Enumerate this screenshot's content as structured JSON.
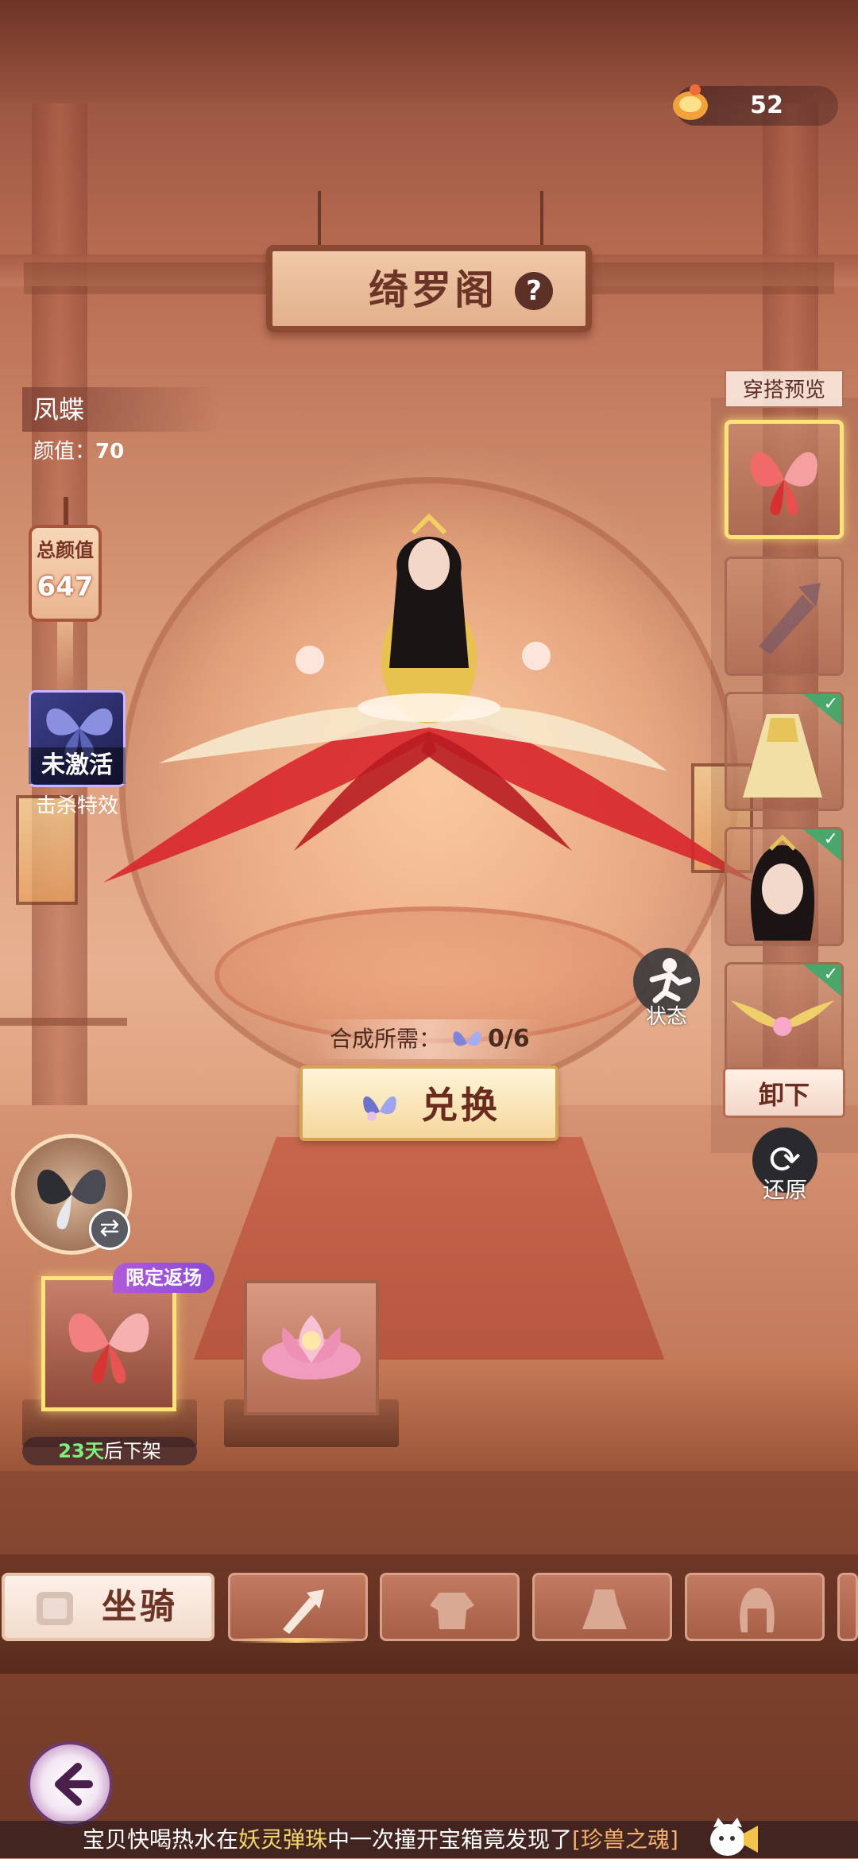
{
  "currency": {
    "amount": "52",
    "icon": "ticket-icon"
  },
  "title": {
    "text": "绮罗阁",
    "help": "?"
  },
  "item": {
    "name": "凤蝶",
    "beauty_label": "颜值：",
    "beauty_value": "70"
  },
  "total_beauty": {
    "label": "总颜值",
    "value": "647"
  },
  "kill_effect": {
    "status": "未激活",
    "label": "击杀特效"
  },
  "preview": {
    "title": "穿搭预览",
    "slots": [
      {
        "name": "butterfly-wings",
        "selected": true,
        "equipped": false
      },
      {
        "name": "weapon-empty",
        "selected": false,
        "equipped": false
      },
      {
        "name": "golden-dress",
        "selected": false,
        "equipped": true
      },
      {
        "name": "hairstyle",
        "selected": false,
        "equipped": true
      },
      {
        "name": "golden-wings",
        "selected": false,
        "equipped": true
      }
    ]
  },
  "controls": {
    "unload": "卸下",
    "restore": "还原",
    "status": "状态"
  },
  "synthesis": {
    "label": "合成所需：",
    "count": "0/6"
  },
  "exchange": {
    "label": "兑换"
  },
  "shelf": {
    "limited_tag": "限定返场",
    "timer_days": "23天",
    "timer_suffix": "后下架"
  },
  "tabs": {
    "active_label": "坐骑"
  },
  "ticker": {
    "part1": "宝贝快喝热水在",
    "part2": "妖灵弹珠",
    "part3": "中一次撞开宝箱竟发现了",
    "part4": "[珍兽之魂]"
  },
  "colors": {
    "selected_border": "#ffe27a",
    "equipped_check": "#4aa76b",
    "limited_tag": "#a04ed6",
    "timer_green": "#7ef07e"
  }
}
